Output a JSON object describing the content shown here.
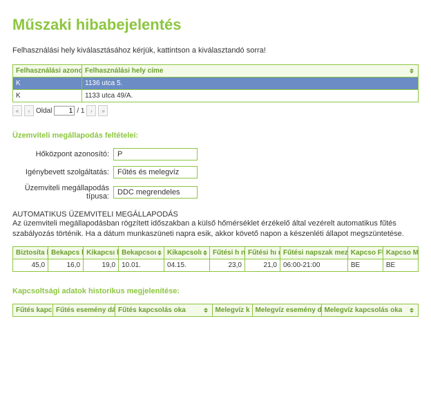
{
  "title": "Műszaki hibabejelentés",
  "instruction": "Felhasználási hely kiválasztásához kérjük, kattintson a kiválasztandó sorra!",
  "locations": {
    "headers": [
      "Felhasználási azonosítója",
      "Felhasználási hely címe"
    ],
    "rows": [
      {
        "id": "K",
        "addr": "1136                  utca 5.",
        "selected": true
      },
      {
        "id": "K",
        "addr": "1133             utca 49/A.",
        "selected": false
      }
    ]
  },
  "pager": {
    "label": "Oldal",
    "page": "1",
    "total": "/ 1"
  },
  "conditions_title": "Üzemviteli megállapodás feltételei:",
  "form": {
    "hokozpont_label": "Hőközpont azonosító:",
    "hokozpont_value": "P",
    "szolg_label": "Igénybevett szolgáltatás:",
    "szolg_value": "Fűtés és melegvíz",
    "tipus_label": "Üzemviteli megállapodás típusa:",
    "tipus_value": "DDC megrendeles"
  },
  "auto": {
    "title": "AUTOMATIKUS ÜZEMVITELI MEGÁLLAPODÁS",
    "desc": "Az üzemviteli megállapodásban rögzített időszakban a külső hőmérséklet érzékelő által vezérelt automatikus fűtés szabályozás történik. Ha a dátum munkaszüneti napra esik, akkor követő napon a készenléti állapot megszüntetése."
  },
  "params": {
    "headers": [
      "Biztosíta hőmérs",
      "Bekapcs hőmérs",
      "Kikapcsı hőmérs",
      "Bekapcsoı",
      "Kikapcsolı",
      "Fűtési h napszak",
      "Fűtési hı napszak",
      "Fűtési napszak mezők értéke",
      "Kapcso FŰTÉS",
      "Kapcso MELEG"
    ],
    "row": [
      "45,0",
      "16,0",
      "19,0",
      "10.01.",
      "04.15.",
      "23,0",
      "21,0",
      "06:00-21:00",
      "BE",
      "BE"
    ]
  },
  "history_title": "Kapcsoltsági adatok historikus megjelenítése:",
  "history": {
    "headers": [
      "Fűtés kapc irány",
      "Fűtés esemény dátuma",
      "Fűtés kapcsolás oka",
      "Melegvíz k irány",
      "Melegvíz esemény dátuma",
      "Melegvíz kapcsolás oka"
    ]
  }
}
